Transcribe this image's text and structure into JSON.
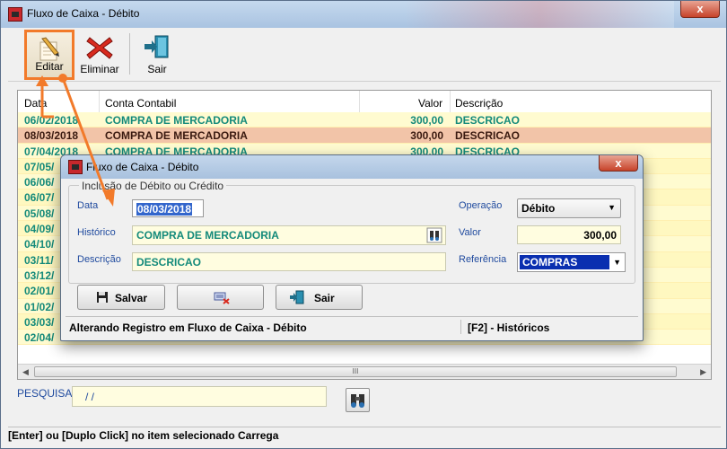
{
  "window": {
    "title": "Fluxo de Caixa - Débito",
    "close": "x"
  },
  "toolbar": {
    "edit_label": "Editar",
    "delete_label": "Eliminar",
    "exit_label": "Sair"
  },
  "grid": {
    "columns": [
      "Data",
      "Conta Contabil",
      "Valor",
      "Descrição"
    ],
    "rows": [
      {
        "data": "06/02/2018",
        "conta": "COMPRA DE MERCADORIA",
        "valor": "300,00",
        "desc": "DESCRICAO"
      },
      {
        "data": "08/03/2018",
        "conta": "COMPRA DE MERCADORIA",
        "valor": "300,00",
        "desc": "DESCRICAO"
      },
      {
        "data": "07/04/2018",
        "conta": "COMPRA DE MERCADORIA",
        "valor": "300,00",
        "desc": "DESCRICAO"
      },
      {
        "data": "07/05/",
        "conta": "",
        "valor": "",
        "desc": ""
      },
      {
        "data": "06/06/",
        "conta": "",
        "valor": "",
        "desc": ""
      },
      {
        "data": "06/07/",
        "conta": "",
        "valor": "",
        "desc": ""
      },
      {
        "data": "05/08/",
        "conta": "",
        "valor": "",
        "desc": ""
      },
      {
        "data": "04/09/",
        "conta": "",
        "valor": "",
        "desc": ""
      },
      {
        "data": "04/10/",
        "conta": "",
        "valor": "",
        "desc": ""
      },
      {
        "data": "03/11/",
        "conta": "",
        "valor": "",
        "desc": ""
      },
      {
        "data": "03/12/",
        "conta": "",
        "valor": "",
        "desc": ""
      },
      {
        "data": "02/01/",
        "conta": "",
        "valor": "",
        "desc": ""
      },
      {
        "data": "01/02/",
        "conta": "",
        "valor": "",
        "desc": ""
      },
      {
        "data": "03/03/",
        "conta": "",
        "valor": "",
        "desc": ""
      },
      {
        "data": "02/04/",
        "conta": "",
        "valor": "",
        "desc": ""
      }
    ],
    "scroll_thumb": "III"
  },
  "search": {
    "label": "PESQUISA",
    "value": "/ /"
  },
  "status": "[Enter] ou [Duplo Click] no item selecionado Carrega",
  "dialog": {
    "title": "Fluxo de Caixa - Débito",
    "close": "x",
    "group_label": "Inclusão de Débito ou Crédito",
    "data_label": "Data",
    "data_value": "08/03/2018",
    "historico_label": "Histórico",
    "historico_value": "COMPRA DE MERCADORIA",
    "descricao_label": "Descrição",
    "descricao_value": "DESCRICAO",
    "operacao_label": "Operação",
    "operacao_value": "Débito",
    "valor_label": "Valor",
    "valor_value": "300,00",
    "referencia_label": "Referência",
    "referencia_value": "COMPRAS",
    "save_label": "Salvar",
    "exit_label": "Sair",
    "status_left": "Alterando Registro em Fluxo de Caixa - Débito",
    "status_right": "[F2] - Históricos"
  },
  "colors": {
    "accent_highlight": "#f27a2a",
    "row_text": "#148a7a",
    "row_bg": "#fffbd0",
    "selected_row_bg": "#f2c4a8",
    "label_blue": "#1f4a9e"
  }
}
